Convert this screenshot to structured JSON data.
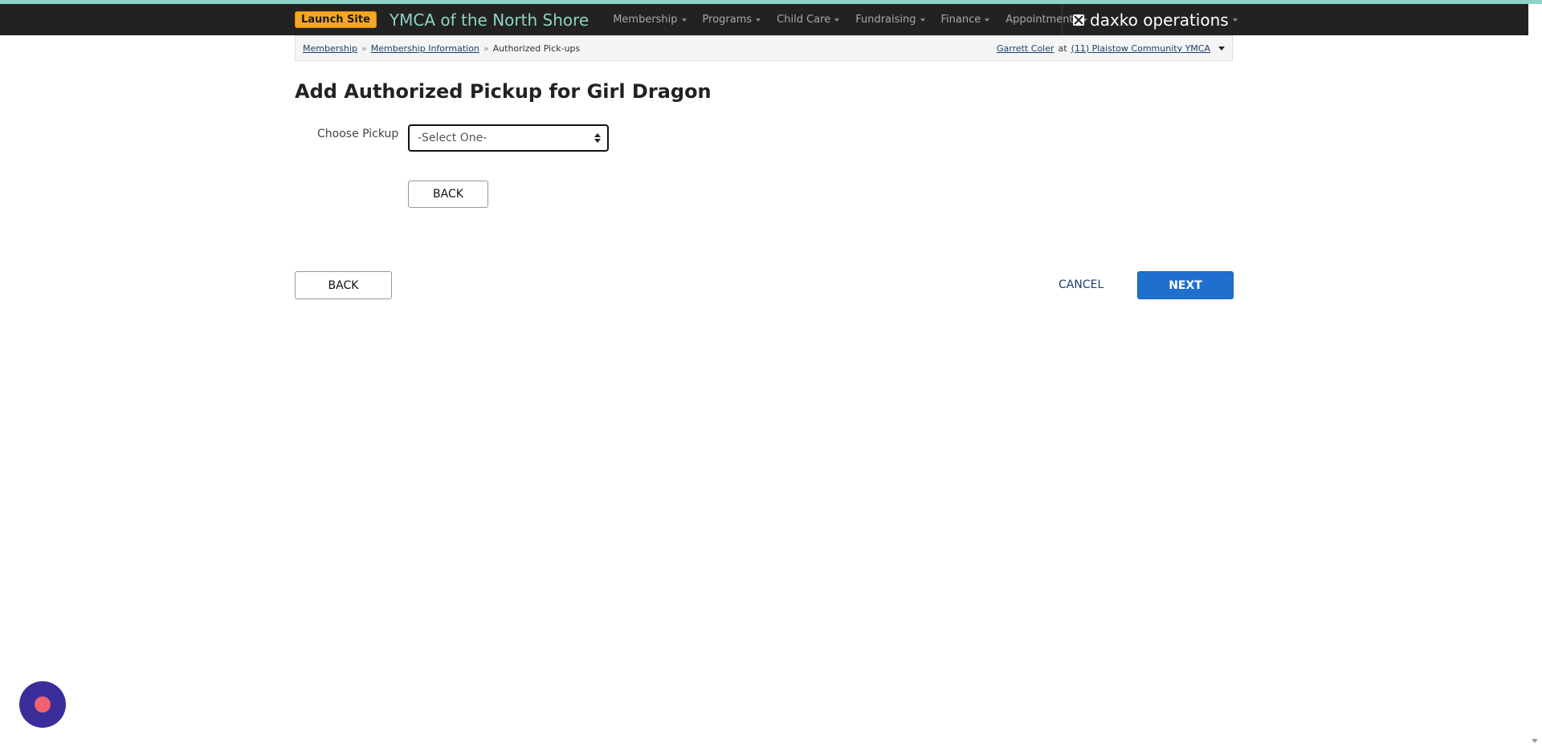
{
  "navbar": {
    "launch_site_label": "Launch Site",
    "brand": "YMCA of the North Shore",
    "menu": [
      {
        "label": "Membership"
      },
      {
        "label": "Programs"
      },
      {
        "label": "Child Care"
      },
      {
        "label": "Fundraising"
      },
      {
        "label": "Finance"
      },
      {
        "label": "Appointments"
      }
    ],
    "product_logo": "daxko operations"
  },
  "breadcrumb": {
    "items": [
      {
        "label": "Membership"
      },
      {
        "label": "Membership Information"
      },
      {
        "label": "Authorized Pick-ups"
      }
    ],
    "separator": "»"
  },
  "user": {
    "name": "Garrett Coler",
    "at": "at",
    "location": "(11) Plaistow Community YMCA"
  },
  "page": {
    "title": "Add Authorized Pickup for Girl Dragon"
  },
  "form": {
    "choose_pickup_label": "Choose Pickup",
    "choose_pickup_value": "-Select One-",
    "inner_back_label": "BACK"
  },
  "footer": {
    "back_label": "BACK",
    "cancel_label": "CANCEL",
    "next_label": "NEXT"
  },
  "colors": {
    "accent": "#8fd3c3",
    "nav_bg": "#222222",
    "launch": "#f5a623",
    "primary": "#1f6fcf",
    "chat_widget": "#3a2e9b"
  }
}
